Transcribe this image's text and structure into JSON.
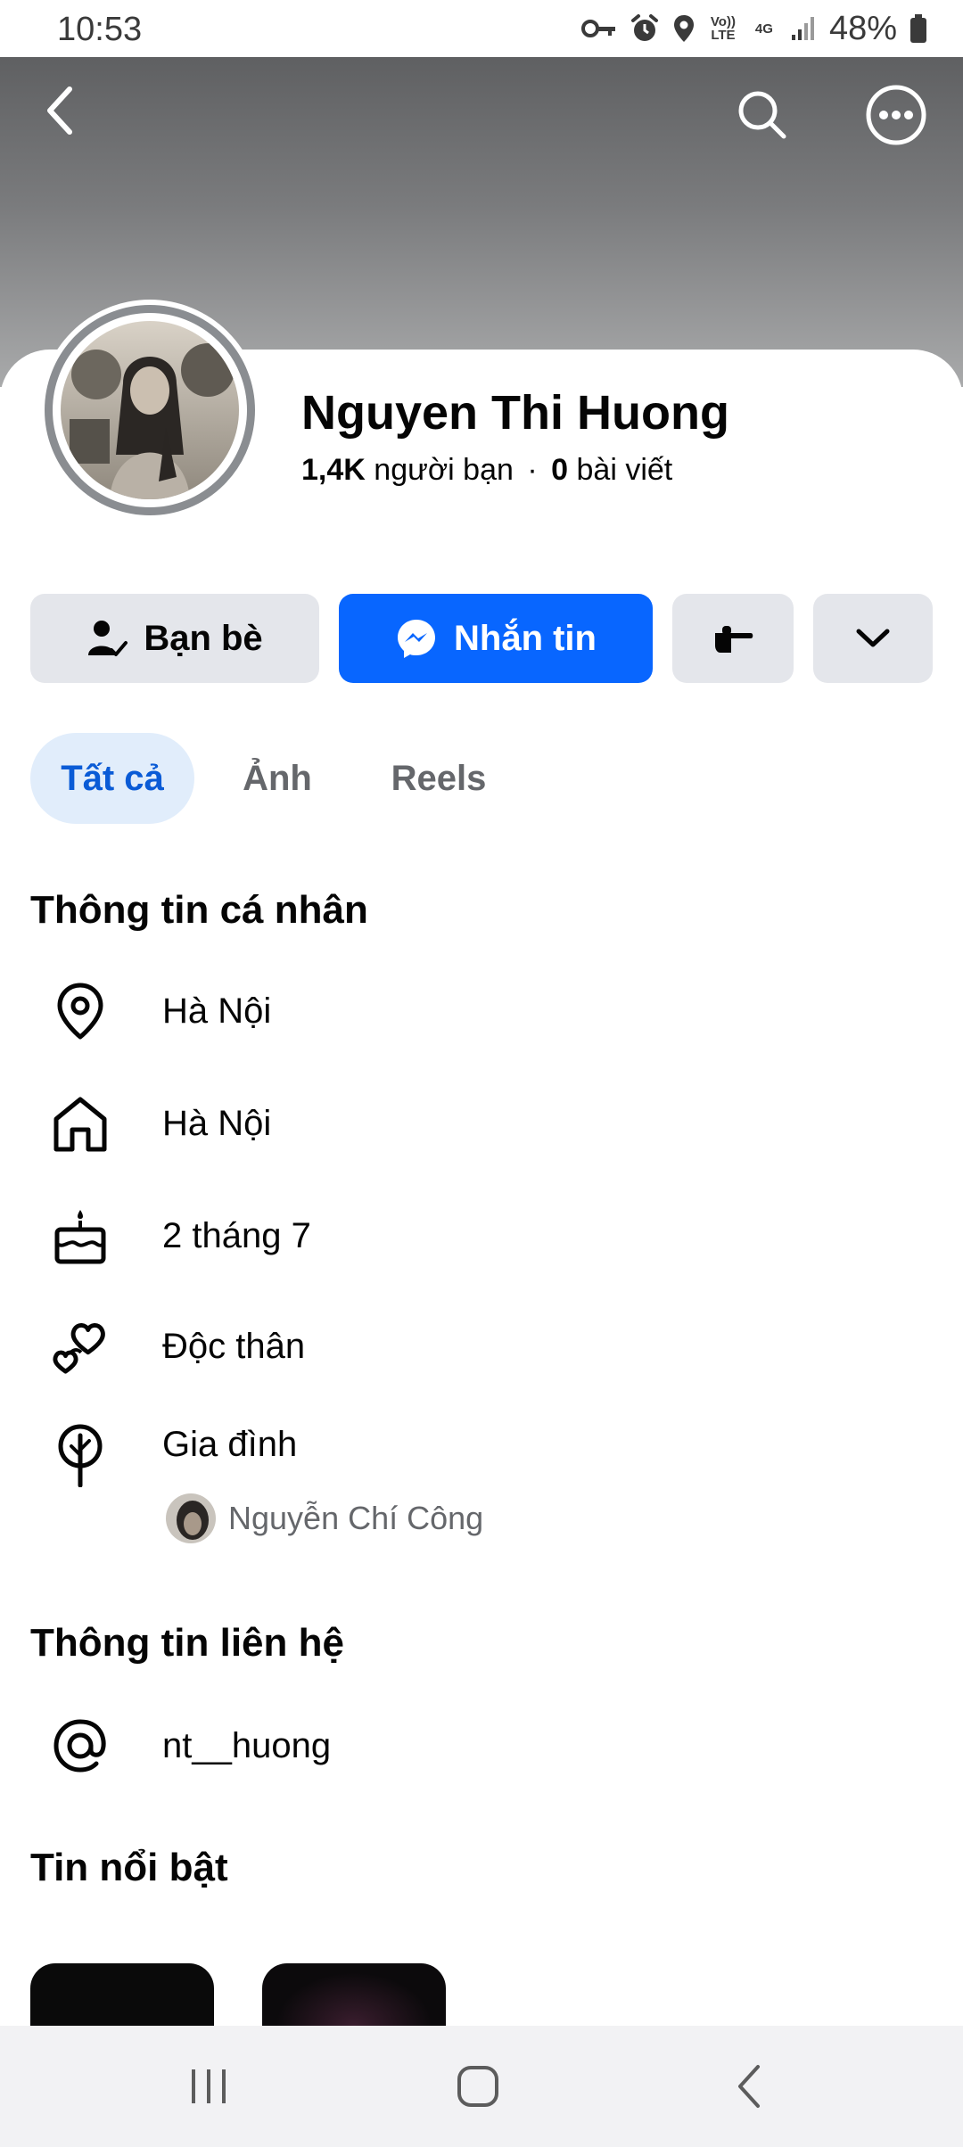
{
  "status_bar": {
    "time": "10:53",
    "volte_label": "Vo)) LTE",
    "network_label": "4G",
    "battery": "48%"
  },
  "header": {
    "back_icon": "chevron-left-icon",
    "search_icon": "search-icon",
    "more_icon": "more-dots-icon"
  },
  "profile": {
    "name": "Nguyen Thi Huong",
    "friends_count": "1,4K",
    "friends_label": "người bạn",
    "separator": "·",
    "posts_count": "0",
    "posts_label": "bài viết"
  },
  "actions": {
    "friends_button": "Bạn bè",
    "message_button": "Nhắn tin"
  },
  "tabs": [
    {
      "label": "Tất cả",
      "active": true
    },
    {
      "label": "Ảnh",
      "active": false
    },
    {
      "label": "Reels",
      "active": false
    }
  ],
  "personal_info": {
    "title": "Thông tin cá nhân",
    "items": [
      {
        "icon": "location-pin-icon",
        "text": "Hà Nội"
      },
      {
        "icon": "home-icon",
        "text": "Hà Nội"
      },
      {
        "icon": "birthday-cake-icon",
        "text": "2 tháng 7"
      },
      {
        "icon": "hearts-icon",
        "text": "Độc thân"
      },
      {
        "icon": "family-tree-icon",
        "text": "Gia đình"
      }
    ],
    "family_member": "Nguyễn Chí Công"
  },
  "contact_info": {
    "title": "Thông tin liên hệ",
    "items": [
      {
        "icon": "at-sign-icon",
        "text": "nt__huong"
      }
    ]
  },
  "featured": {
    "title": "Tin nổi bật"
  },
  "colors": {
    "accent": "#0866ff",
    "tab_active_bg": "#e1edfb",
    "tab_active_text": "#0a5bd6",
    "button_grey": "#e4e6eb"
  }
}
